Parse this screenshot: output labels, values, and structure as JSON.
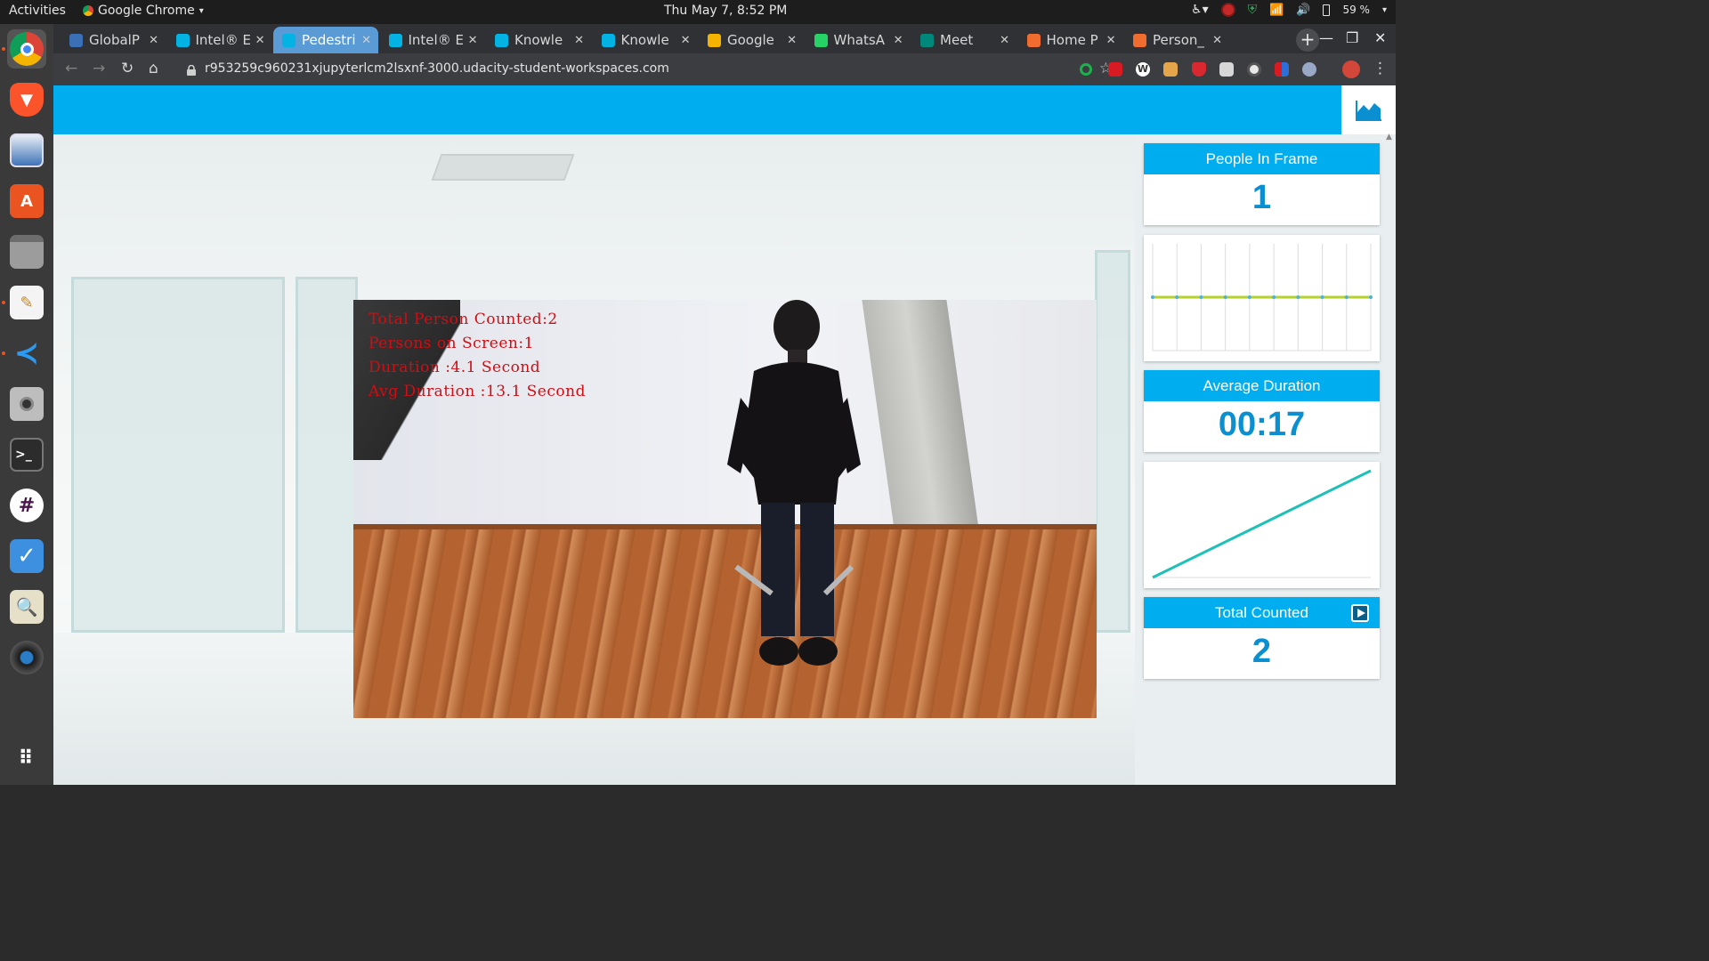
{
  "system": {
    "activities": "Activities",
    "app_name": "Google Chrome",
    "clock": "Thu May  7,  8:52 PM",
    "battery": "59 %"
  },
  "dock": {
    "apps": [
      "chrome",
      "brave",
      "image-viewer",
      "software-center",
      "files",
      "text-editor",
      "vscode",
      "screenshot",
      "terminal",
      "slack",
      "tasks",
      "image-editor",
      "webcam"
    ]
  },
  "browser": {
    "tabs": [
      {
        "label": "GlobalP",
        "favicon_color": "#3b6fb6"
      },
      {
        "label": "Intel® E",
        "favicon_color": "#02b3e4"
      },
      {
        "label": "Pedestri",
        "favicon_color": "#02b3e4",
        "active": true
      },
      {
        "label": "Intel® E",
        "favicon_color": "#02b3e4"
      },
      {
        "label": "Knowle",
        "favicon_color": "#02b3e4"
      },
      {
        "label": "Knowle",
        "favicon_color": "#02b3e4"
      },
      {
        "label": "Google",
        "favicon_color": "#f4b400"
      },
      {
        "label": "WhatsA",
        "favicon_color": "#25d366"
      },
      {
        "label": "Meet",
        "favicon_color": "#00897b"
      },
      {
        "label": "Home P",
        "favicon_color": "#f06d2f"
      },
      {
        "label": "Person_",
        "favicon_color": "#f06d2f"
      }
    ],
    "url": "r953259c960231xjupyterlcm2lsxnf-3000.udacity-student-workspaces.com"
  },
  "video_overlay": {
    "lines": [
      "Total Person Counted:2",
      "Persons on Screen:1",
      "Duration :4.1 Second",
      "Avg Duration :13.1 Second"
    ]
  },
  "stats": {
    "people_in_frame_title": "People In Frame",
    "people_in_frame_value": "1",
    "average_duration_title": "Average Duration",
    "average_duration_value": "00:17",
    "total_counted_title": "Total Counted",
    "total_counted_value": "2",
    "colors": {
      "accent": "#00adef",
      "value": "#0a8fd0",
      "people_line": "#b5d22a",
      "duration_line": "#1ec0b8"
    }
  },
  "chart_data": [
    {
      "type": "line",
      "series": [
        {
          "values": [
            1,
            1,
            1,
            1,
            1,
            1,
            1,
            1,
            1,
            1
          ]
        }
      ]
    },
    {
      "type": "line",
      "series": [
        {
          "values": [
            0,
            1
          ]
        }
      ]
    }
  ]
}
